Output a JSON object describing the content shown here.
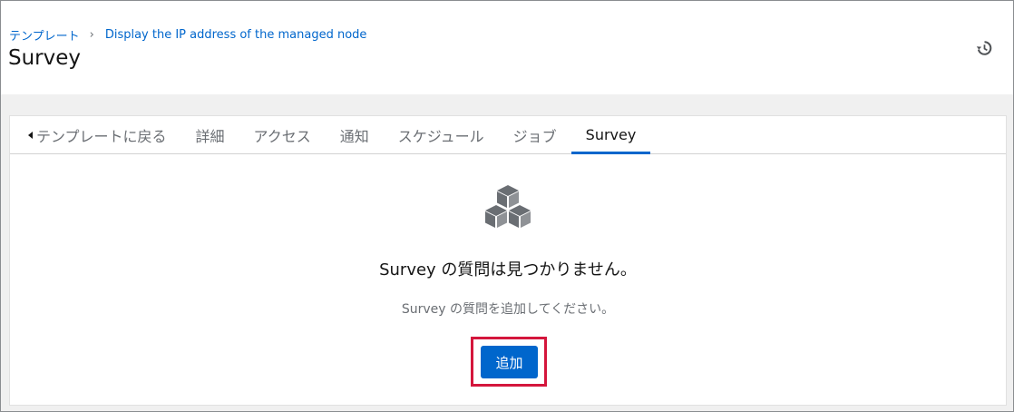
{
  "breadcrumb": {
    "root_label": "テンプレート",
    "current_label": "Display the IP address of the managed node"
  },
  "page": {
    "title": "Survey"
  },
  "header": {
    "history_icon": "history-icon"
  },
  "tabs": [
    {
      "label": "テンプレートに戻る",
      "icon": "caret-left-icon"
    },
    {
      "label": "詳細"
    },
    {
      "label": "アクセス"
    },
    {
      "label": "通知"
    },
    {
      "label": "スケジュール"
    },
    {
      "label": "ジョブ"
    },
    {
      "label": "Survey",
      "active": true
    }
  ],
  "empty_state": {
    "icon": "cubes-icon",
    "title": "Survey の質問は見つかりません。",
    "body": "Survey の質問を追加してください。",
    "add_button_label": "追加"
  },
  "colors": {
    "link": "#0066cc",
    "primary_button": "#0066cc",
    "highlight_border": "#d4163c",
    "tab_active_indicator": "#0066cc"
  }
}
